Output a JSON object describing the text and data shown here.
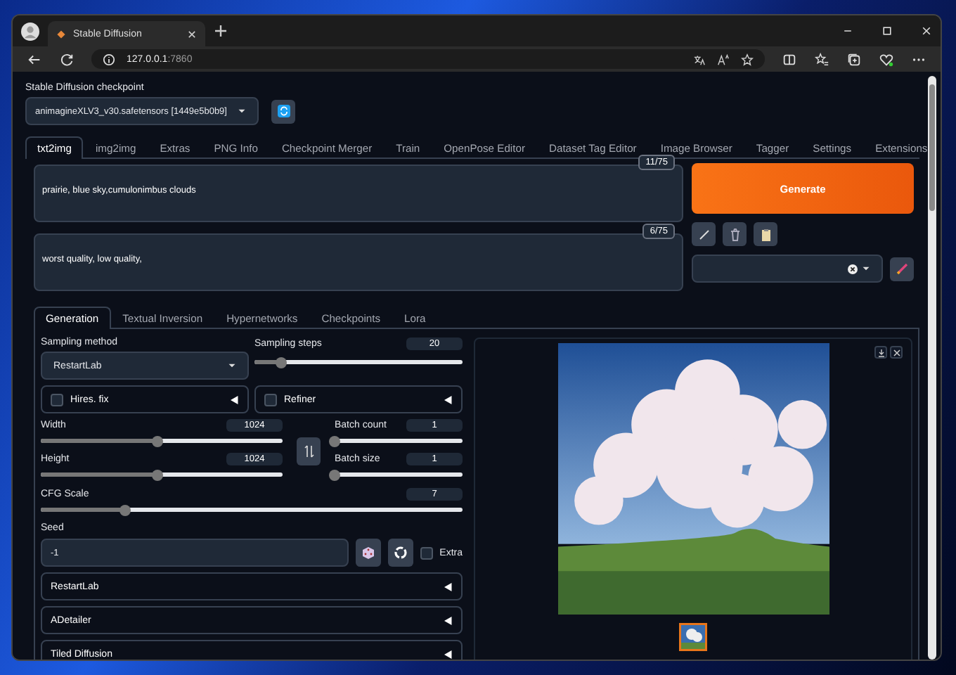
{
  "browser": {
    "tab_title": "Stable Diffusion",
    "url_host": "127.0.0.1",
    "url_port": ":7860"
  },
  "checkpoint": {
    "label": "Stable Diffusion checkpoint",
    "value": "animagineXLV3_v30.safetensors [1449e5b0b9]"
  },
  "main_tabs": [
    {
      "label": "txt2img",
      "selected": true
    },
    {
      "label": "img2img",
      "selected": false
    },
    {
      "label": "Extras",
      "selected": false
    },
    {
      "label": "PNG Info",
      "selected": false
    },
    {
      "label": "Checkpoint Merger",
      "selected": false
    },
    {
      "label": "Train",
      "selected": false
    },
    {
      "label": "OpenPose Editor",
      "selected": false
    },
    {
      "label": "Dataset Tag Editor",
      "selected": false
    },
    {
      "label": "Image Browser",
      "selected": false
    },
    {
      "label": "Tagger",
      "selected": false
    },
    {
      "label": "Settings",
      "selected": false
    },
    {
      "label": "Extensions",
      "selected": false
    }
  ],
  "prompt": {
    "value": "prairie, blue sky,cumulonimbus clouds",
    "token_count": "11/75"
  },
  "negative_prompt": {
    "value": "worst quality, low quality,",
    "token_count": "6/75"
  },
  "generate_button": "Generate",
  "sub_tabs": [
    {
      "label": "Generation",
      "selected": true
    },
    {
      "label": "Textual Inversion",
      "selected": false
    },
    {
      "label": "Hypernetworks",
      "selected": false
    },
    {
      "label": "Checkpoints",
      "selected": false
    },
    {
      "label": "Lora",
      "selected": false
    }
  ],
  "sampling_method": {
    "label": "Sampling method",
    "value": "RestartLab"
  },
  "sampling_steps": {
    "label": "Sampling steps",
    "value": "20",
    "level": 0.13
  },
  "hires_fix": {
    "label": "Hires. fix",
    "checked": false
  },
  "refiner": {
    "label": "Refiner",
    "checked": false
  },
  "size_sliders": [
    {
      "label": "Width",
      "value": "1024",
      "level": 0.48
    },
    {
      "label": "Height",
      "value": "1024",
      "level": 0.48
    }
  ],
  "batch_sliders": [
    {
      "label": "Batch count",
      "value": "1",
      "level": 0.0
    },
    {
      "label": "Batch size",
      "value": "1",
      "level": 0.0
    }
  ],
  "cfg_scale": {
    "label": "CFG Scale",
    "value": "7",
    "level": 0.2
  },
  "seed": {
    "label": "Seed",
    "value": "-1"
  },
  "extra": {
    "label": "Extra",
    "checked": false
  },
  "accordions": [
    {
      "label": "RestartLab"
    },
    {
      "label": "ADetailer"
    },
    {
      "label": "Tiled Diffusion"
    }
  ]
}
